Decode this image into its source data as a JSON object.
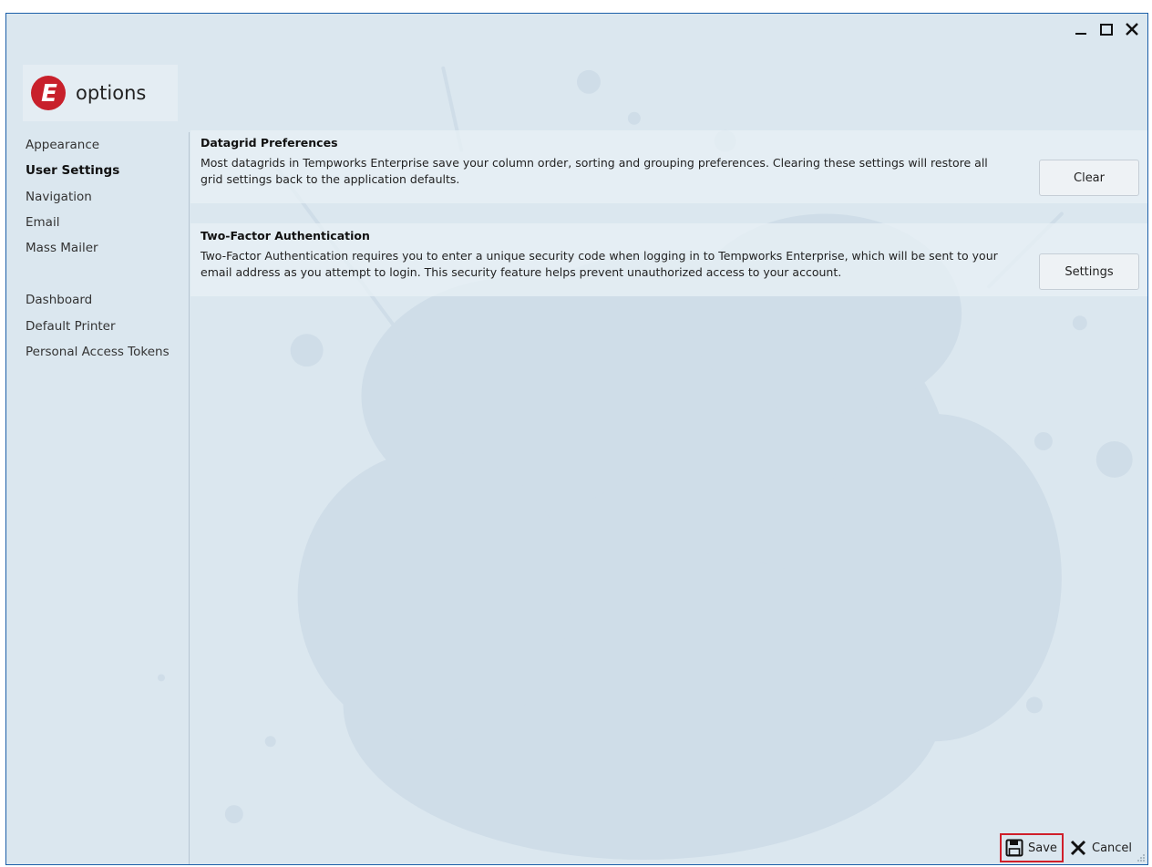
{
  "window": {
    "controls": {
      "minimize_icon": "minimize-icon",
      "maximize_icon": "maximize-icon",
      "close_icon": "close-icon"
    }
  },
  "header": {
    "logo_letter": "E",
    "title": "options",
    "accent": "#c8202b"
  },
  "sidebar": {
    "items": [
      {
        "label": "Appearance",
        "active": false
      },
      {
        "label": "User Settings",
        "active": true
      },
      {
        "label": "Navigation",
        "active": false
      },
      {
        "label": "Email",
        "active": false
      },
      {
        "label": "Mass Mailer",
        "active": false
      },
      {
        "label": "Dashboard",
        "active": false
      },
      {
        "label": "Default Printer",
        "active": false
      },
      {
        "label": "Personal Access Tokens",
        "active": false
      }
    ]
  },
  "main": {
    "datagrid": {
      "title": "Datagrid Preferences",
      "description": "Most datagrids in Tempworks Enterprise save your column order, sorting and grouping preferences.  Clearing these settings will restore all grid settings back to the application defaults.",
      "button_label": "Clear"
    },
    "two_factor": {
      "title": "Two-Factor Authentication",
      "description": "Two-Factor Authentication requires you to enter a unique security code when logging in to Tempworks Enterprise, which will be sent to your email address as you attempt to login. This security feature helps prevent unauthorized access to your account.",
      "button_label": "Settings"
    }
  },
  "footer": {
    "save_label": "Save",
    "save_icon": "floppy-disk-icon",
    "cancel_label": "Cancel",
    "cancel_icon": "x-icon",
    "highlight_color": "#d01f2a"
  }
}
